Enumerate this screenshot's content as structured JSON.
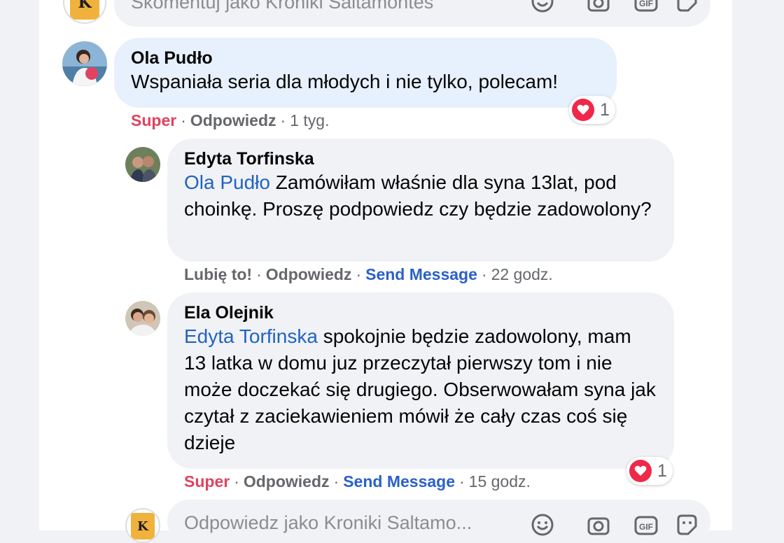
{
  "composer_top": {
    "placeholder": "Skomentuj jako Kroniki Saltamontes",
    "logo_letter": "K"
  },
  "comments": [
    {
      "author": "Ola Pudło",
      "text": "Wspaniała seria dla młodych i nie tylko, polecam!",
      "reaction_label": "Super",
      "reply_label": "Odpowiedz",
      "time": "1 tyg.",
      "reaction_count": "1"
    },
    {
      "author": "Edyta Torfinska",
      "mention": "Ola Pudło",
      "text": " Zamówiłam właśnie dla syna 13lat, pod choinkę. Proszę podpowiedz czy będzie zadowolony?",
      "reaction_label": "Lubię to!",
      "reply_label": "Odpowiedz",
      "send_label": "Send Message",
      "time": "22 godz."
    },
    {
      "author": "Ela Olejnik",
      "mention": "Edyta Torfinska",
      "text": " spokojnie będzie zadowolony, mam 13 latka w domu juz przeczytał pierwszy tom i nie może doczekać się drugiego. Obserwowałam syna jak czytał z zaciekawieniem mówił że cały czas coś się dzieje",
      "reaction_label": "Super",
      "reply_label": "Odpowiedz",
      "send_label": "Send Message",
      "time": "15 godz.",
      "reaction_count": "1"
    }
  ],
  "composer_bottom": {
    "placeholder": "Odpowiedz jako Kroniki Saltamo...",
    "logo_letter": "K"
  },
  "icons": [
    "smile-icon",
    "camera-icon",
    "gif-icon",
    "sticker-icon",
    "heart-icon"
  ],
  "colors": {
    "mention": "#2163c2",
    "super": "#e0435f",
    "send_message": "#2a61c9",
    "heart": "#f02849",
    "bubble_highlight": "#e7f0fd",
    "bubble": "#f0f2f5"
  }
}
